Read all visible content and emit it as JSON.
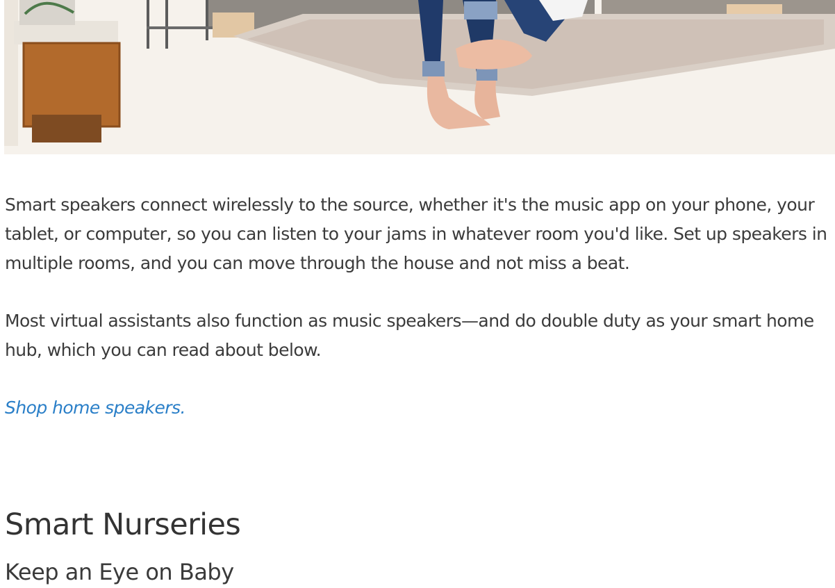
{
  "hero": {
    "image_icon": "photo-icon"
  },
  "article": {
    "paragraphs": [
      "Smart speakers connect wirelessly to the source, whether it's the music app on your phone, your tablet, or computer, so you can listen to your jams in whatever room you'd like. Set up speakers in multiple rooms, and you can move through the house and not miss a beat.",
      "Most virtual assistants also function as music speakers—and do double duty as your smart home hub, which you can read about below."
    ],
    "shop_link": "Shop home speakers."
  },
  "section": {
    "title": "Smart Nurseries",
    "subtitle": "Keep an Eye on Baby"
  },
  "colors": {
    "link": "#2a7fc8",
    "text": "#3b3b3b",
    "heading": "#333333"
  }
}
